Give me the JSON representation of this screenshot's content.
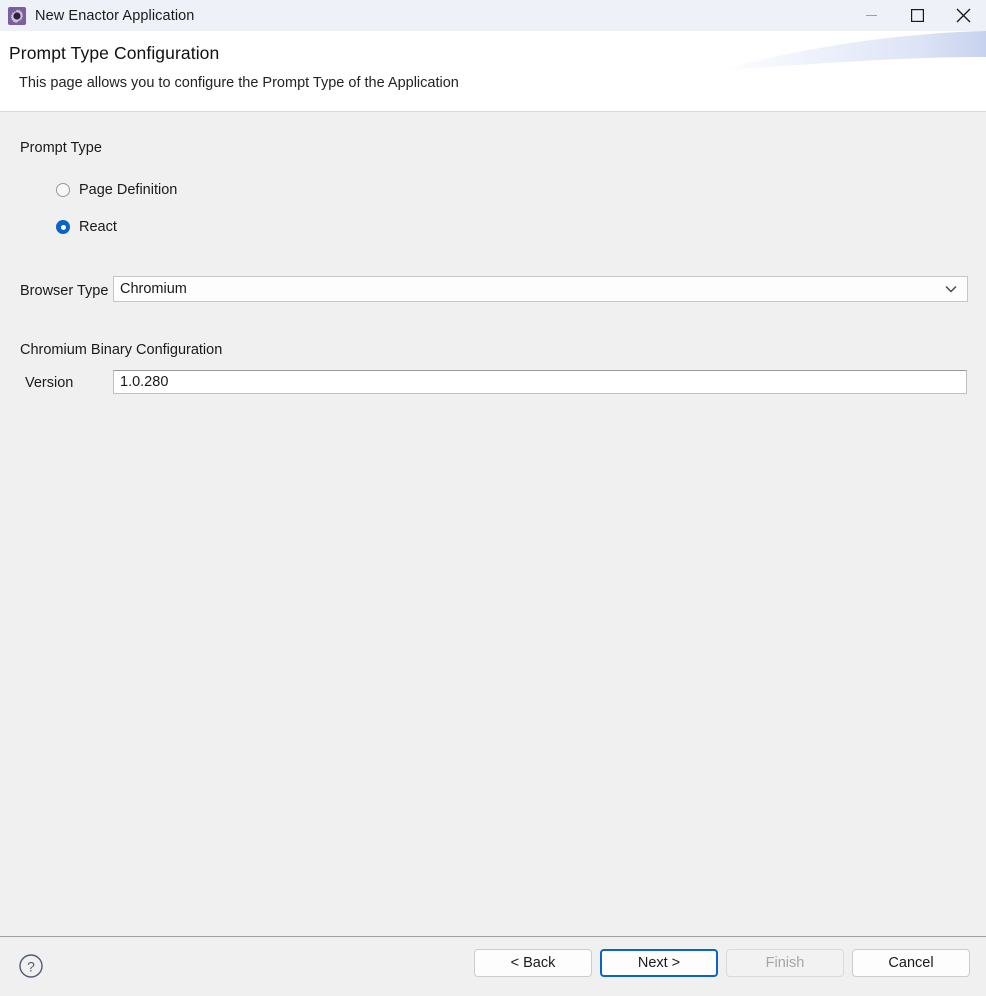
{
  "window": {
    "title": "New Enactor Application",
    "icon": "enactor-gear-icon",
    "controls": {
      "minimize": "minimize-icon",
      "maximize": "maximize-icon",
      "close": "close-icon"
    }
  },
  "header": {
    "title": "Prompt Type Configuration",
    "description": "This page allows you to configure the Prompt Type of the Application"
  },
  "form": {
    "prompt_type_group_label": "Prompt Type",
    "radios": [
      {
        "label": "Page Definition",
        "selected": false
      },
      {
        "label": "React",
        "selected": true
      }
    ],
    "browser_type_label": "Browser Type",
    "browser_type_value": "Chromium",
    "chromium_group_label": "Chromium Binary Configuration",
    "version_label": "Version",
    "version_value": "1.0.280"
  },
  "footer": {
    "help": "help-icon",
    "buttons": [
      {
        "label": "< Back",
        "state": "normal"
      },
      {
        "label": "Next >",
        "state": "focused"
      },
      {
        "label": "Finish",
        "state": "disabled"
      },
      {
        "label": "Cancel",
        "state": "normal"
      }
    ]
  },
  "colors": {
    "accent": "#0a64c8",
    "titlebar_bg": "#eef1f8",
    "body_bg": "#f0f0f0",
    "header_bg": "#ffffff",
    "icon_purple": "#7a5ea0"
  }
}
